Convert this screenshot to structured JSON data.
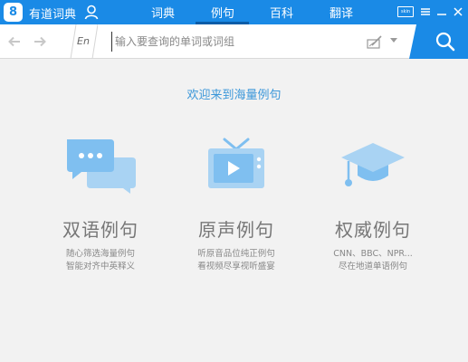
{
  "app": {
    "title": "有道词典",
    "logo_char": "8"
  },
  "tabs": [
    {
      "label": "词典",
      "active": false
    },
    {
      "label": "例句",
      "active": true
    },
    {
      "label": "百科",
      "active": false
    },
    {
      "label": "翻译",
      "active": false
    }
  ],
  "titlebar": {
    "skin_label": "skin"
  },
  "search": {
    "lang": "En",
    "placeholder": "输入要查询的单词或词组",
    "value": ""
  },
  "main": {
    "welcome": "欢迎来到海量例句",
    "features": [
      {
        "title": "双语例句",
        "desc_line1": "随心筛选海量例句",
        "desc_line2": "智能对齐中英释义",
        "icon": "chat-bubbles-icon"
      },
      {
        "title": "原声例句",
        "desc_line1": "听原音品位纯正例句",
        "desc_line2": "看视频尽享视听盛宴",
        "icon": "tv-play-icon"
      },
      {
        "title": "权威例句",
        "desc_line1": "CNN、BBC、NPR...",
        "desc_line2": "尽在地道单语例句",
        "icon": "graduation-cap-icon"
      }
    ]
  },
  "colors": {
    "brand": "#1a8ae6",
    "accent_text": "#3b97d9",
    "icon_light": "#a9d3f3",
    "icon_mid": "#7fbff0"
  }
}
